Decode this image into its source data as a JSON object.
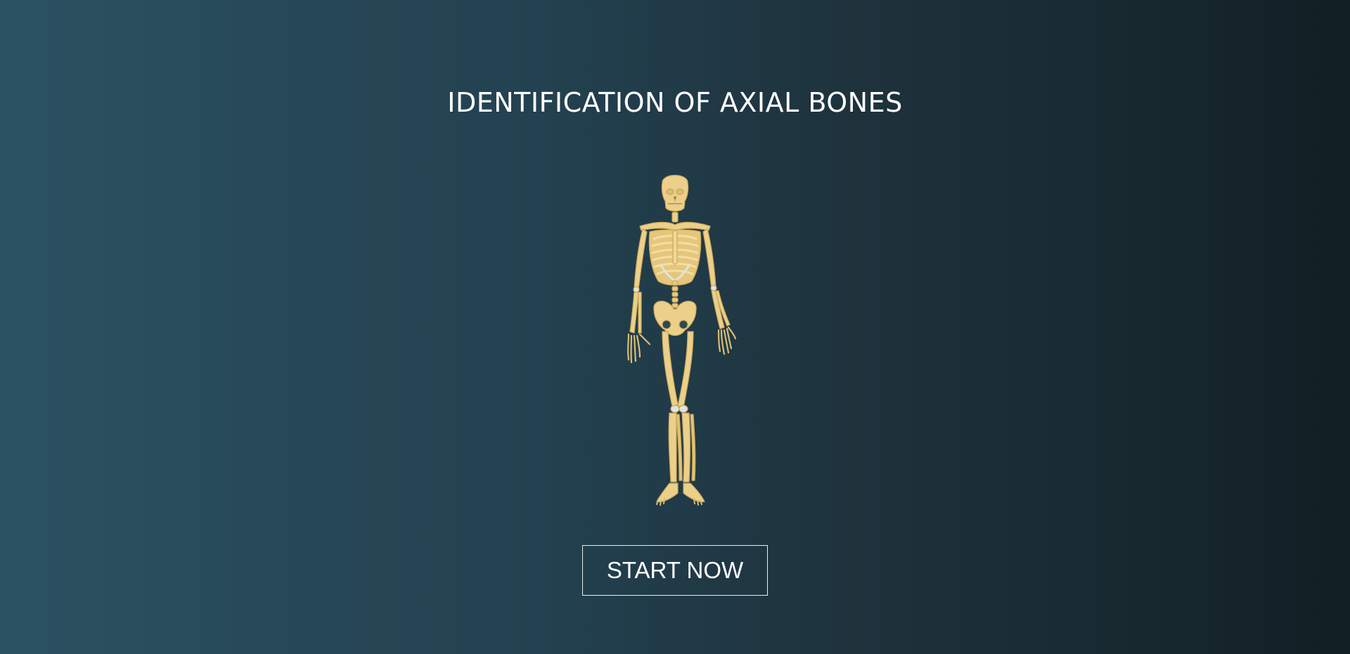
{
  "title": "IDENTIFICATION OF AXIAL BONES",
  "start_button_label": "START NOW",
  "illustration": "skeleton-illustration",
  "colors": {
    "background_left": "#2b5263",
    "background_right": "#111f24",
    "bone": "#ecd08a",
    "bone_shade": "#c9a85a",
    "cartilage": "#dfe3e6",
    "text": "#ffffff"
  }
}
